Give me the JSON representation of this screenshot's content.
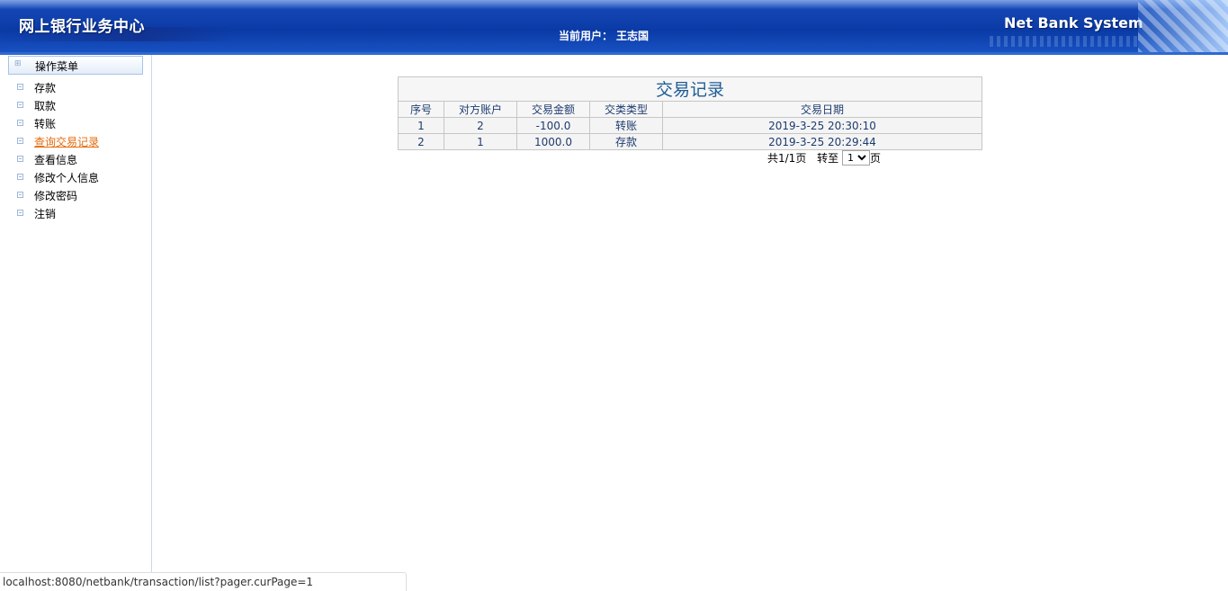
{
  "header": {
    "app_title": "网上银行业务中心",
    "current_user_label": "当前用户：",
    "current_user_name": "王志国",
    "system_name": "Net Bank System"
  },
  "sidebar": {
    "menu_title": "操作菜单",
    "items": [
      {
        "label": "存款",
        "active": false
      },
      {
        "label": "取款",
        "active": false
      },
      {
        "label": "转账",
        "active": false
      },
      {
        "label": "查询交易记录",
        "active": true
      },
      {
        "label": "查看信息",
        "active": false
      },
      {
        "label": "修改个人信息",
        "active": false
      },
      {
        "label": "修改密码",
        "active": false
      },
      {
        "label": "注销",
        "active": false
      }
    ]
  },
  "main": {
    "table_title": "交易记录",
    "columns": [
      "序号",
      "对方账户",
      "交易金额",
      "交类类型",
      "交易日期"
    ],
    "rows": [
      [
        "1",
        "2",
        "-100.0",
        "转账",
        "2019-3-25 20:30:10"
      ],
      [
        "2",
        "1",
        "1000.0",
        "存款",
        "2019-3-25 20:29:44"
      ]
    ],
    "pager": {
      "summary": "共1/1页",
      "goto_label": "转至",
      "page_value": "1",
      "page_suffix": "页"
    }
  },
  "status_bar": {
    "url": "localhost:8080/netbank/transaction/list?pager.curPage=1"
  },
  "colors": {
    "header_blue": "#0a3aa6",
    "active_menu": "#e46b0b",
    "table_title": "#1e5d96"
  }
}
